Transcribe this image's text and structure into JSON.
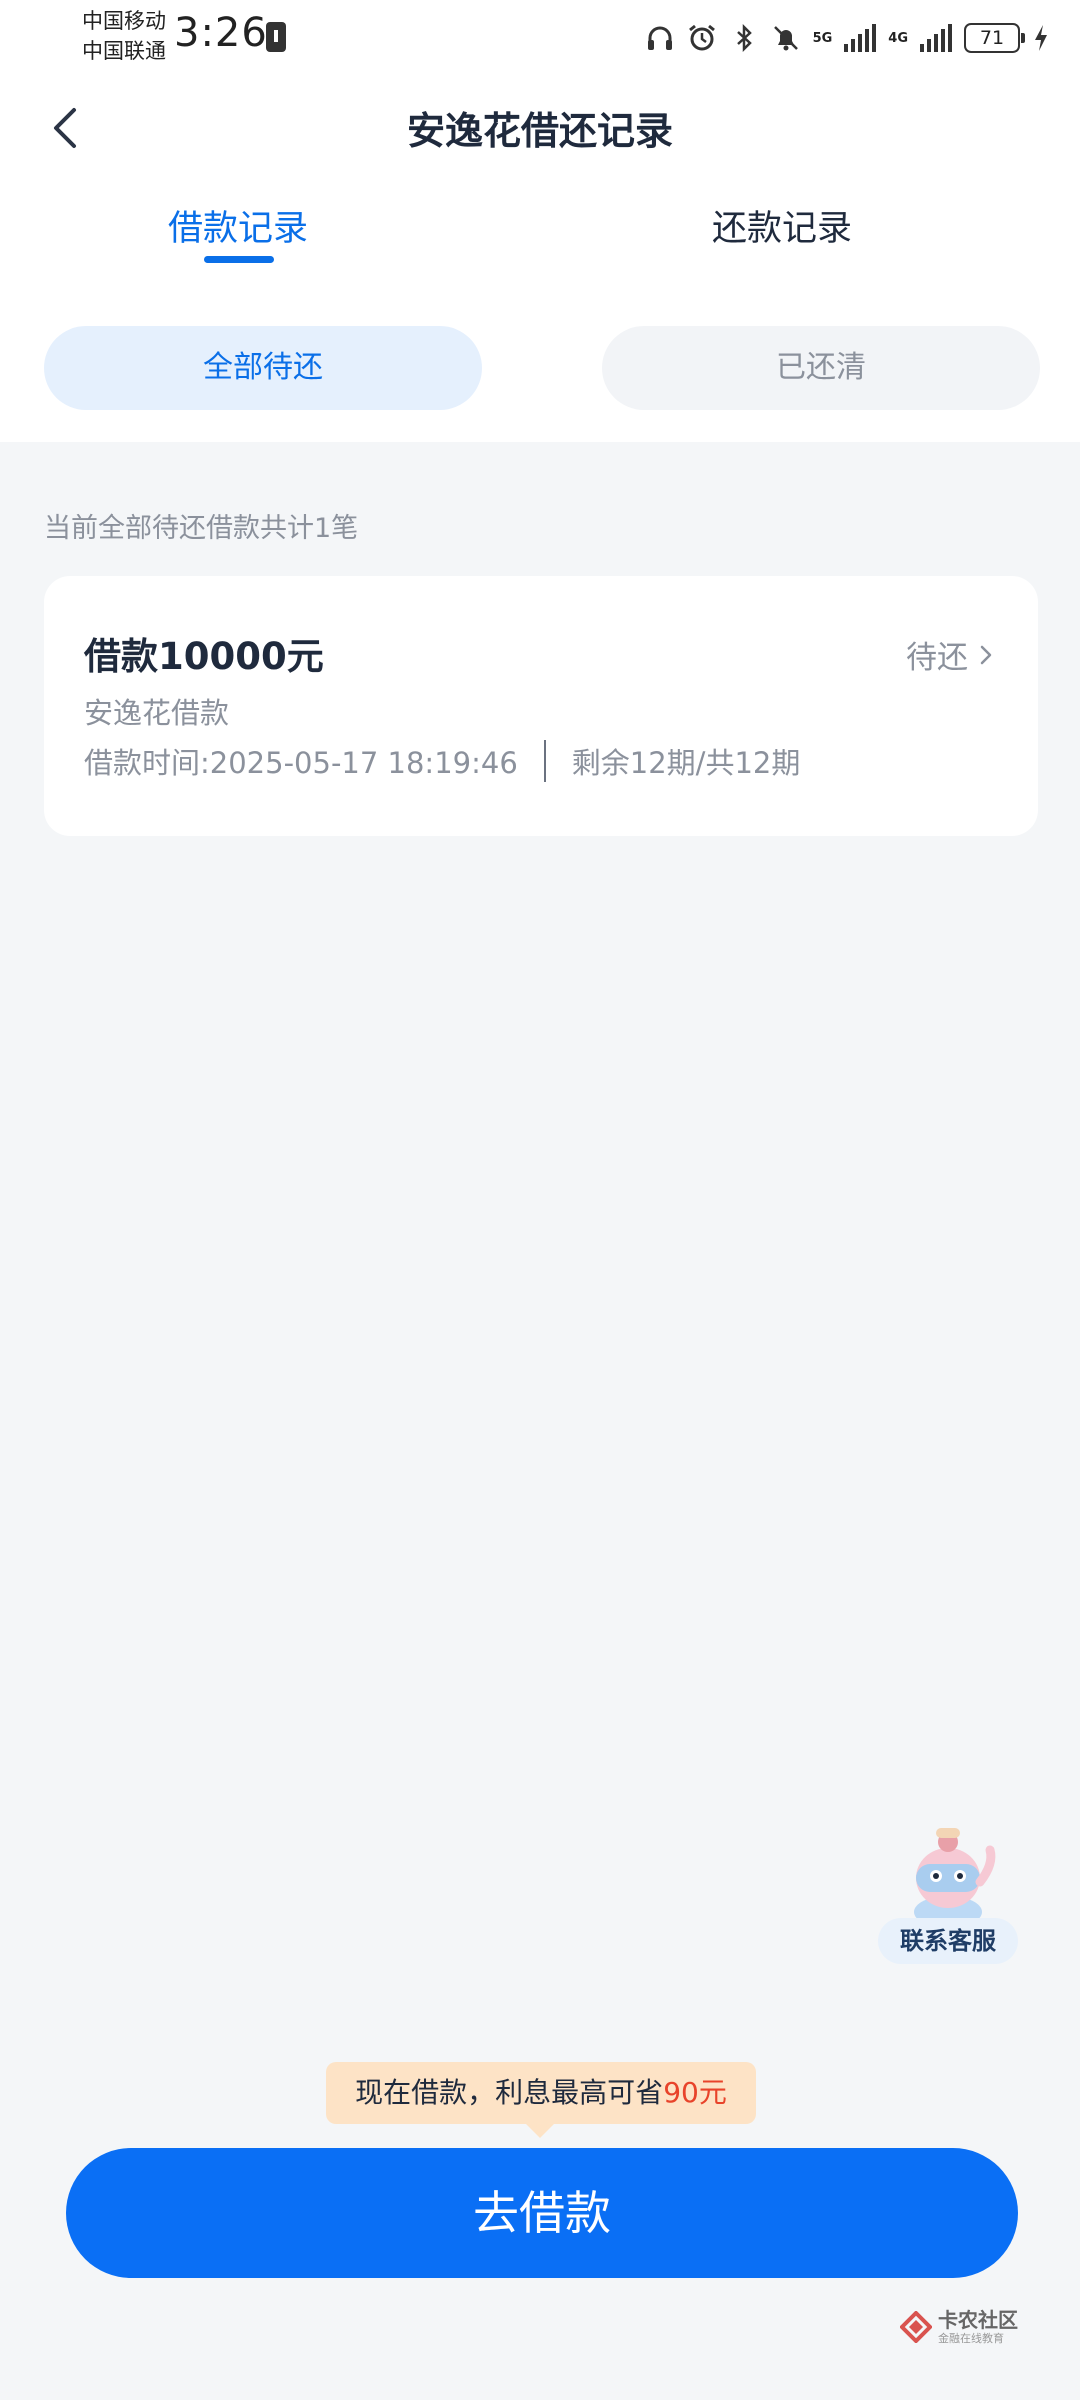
{
  "status_bar": {
    "carrier_1": "中国移动",
    "carrier_2": "中国联通",
    "time": "3:26",
    "network_1": "5G",
    "network_2": "4G",
    "battery": "71"
  },
  "header": {
    "title": "安逸花借还记录"
  },
  "tabs": [
    {
      "label": "借款记录",
      "active": true
    },
    {
      "label": "还款记录",
      "active": false
    }
  ],
  "filters": [
    {
      "label": "全部待还",
      "active": true
    },
    {
      "label": "已还清",
      "active": false
    }
  ],
  "summary": "当前全部待还借款共计1笔",
  "loan": {
    "amount": "借款10000元",
    "status": "待还",
    "product": "安逸花借款",
    "time": "借款时间:2025-05-17 18:19:46",
    "periods": "剩余12期/共12期"
  },
  "customer_service": {
    "label": "联系客服"
  },
  "promo": {
    "text": "现在借款，利息最高可省",
    "highlight": "90元"
  },
  "cta": {
    "label": "去借款"
  },
  "watermark": {
    "main": "卡农社区",
    "sub": "金融在线教育"
  },
  "colors": {
    "accent": "#0a6fe8",
    "button": "#0a6ff5",
    "promo_bg": "#fde3c6",
    "promo_highlight": "#e8432a",
    "page_bg": "#f4f6f8"
  }
}
